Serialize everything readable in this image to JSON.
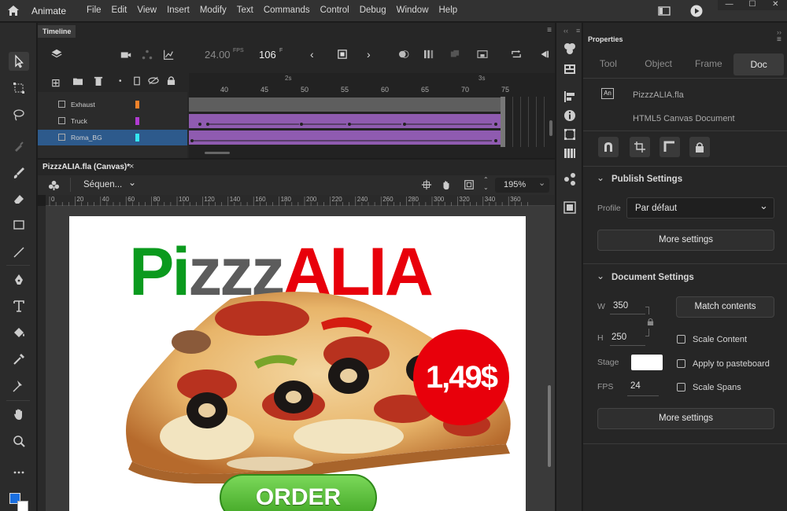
{
  "app": {
    "name": "Animate"
  },
  "menu": [
    "File",
    "Edit",
    "View",
    "Insert",
    "Modify",
    "Text",
    "Commands",
    "Control",
    "Debug",
    "Window",
    "Help"
  ],
  "timeline": {
    "tab": "Timeline",
    "fps": "24.00",
    "fps_unit": "FPS",
    "frame": "106",
    "frame_unit": "F",
    "seconds": [
      "2s",
      "3s"
    ],
    "ruler_numbers": [
      "40",
      "45",
      "50",
      "55",
      "60",
      "65",
      "70",
      "75"
    ],
    "layers": [
      {
        "name": "Exhaust",
        "color": "#f0822a"
      },
      {
        "name": "Truck",
        "color": "#b13bd1"
      },
      {
        "name": "Roma_BG",
        "color": "#34e6f0",
        "selected": true
      }
    ]
  },
  "document": {
    "tab": "PizzzALIA.fla (Canvas)*",
    "close": "×",
    "scene": "Séquen...",
    "zoom": "195%",
    "ruler": [
      "0",
      "20",
      "40",
      "60",
      "80",
      "100",
      "120",
      "140",
      "160",
      "180",
      "200",
      "220",
      "240",
      "260",
      "280",
      "300",
      "320",
      "340",
      "360"
    ]
  },
  "stage": {
    "title_part1": "Pi",
    "title_part2": "zzz",
    "title_part3": "ALIA",
    "price": "1,49$",
    "order": "ORDER",
    "colors": {
      "green": "#0b9a1e",
      "gray": "#5c5c5c",
      "red": "#e8000b",
      "button": "#46b52b"
    }
  },
  "properties": {
    "tab": "Properties",
    "tabs": [
      "Tool",
      "Object",
      "Frame",
      "Doc"
    ],
    "file_name": "PizzzALIA.fla",
    "doc_type": "HTML5 Canvas Document",
    "file_badge": "An",
    "publish": {
      "title": "Publish Settings",
      "profile_label": "Profile",
      "profile_value": "Par défaut",
      "more": "More settings"
    },
    "docset": {
      "title": "Document Settings",
      "w_label": "W",
      "w": "350",
      "h_label": "H",
      "h": "250",
      "match": "Match contents",
      "stage_label": "Stage",
      "fps_label": "FPS",
      "fps": "24",
      "scale_content": "Scale Content",
      "apply_paste": "Apply to pasteboard",
      "scale_spans": "Scale Spans",
      "more": "More settings"
    }
  }
}
